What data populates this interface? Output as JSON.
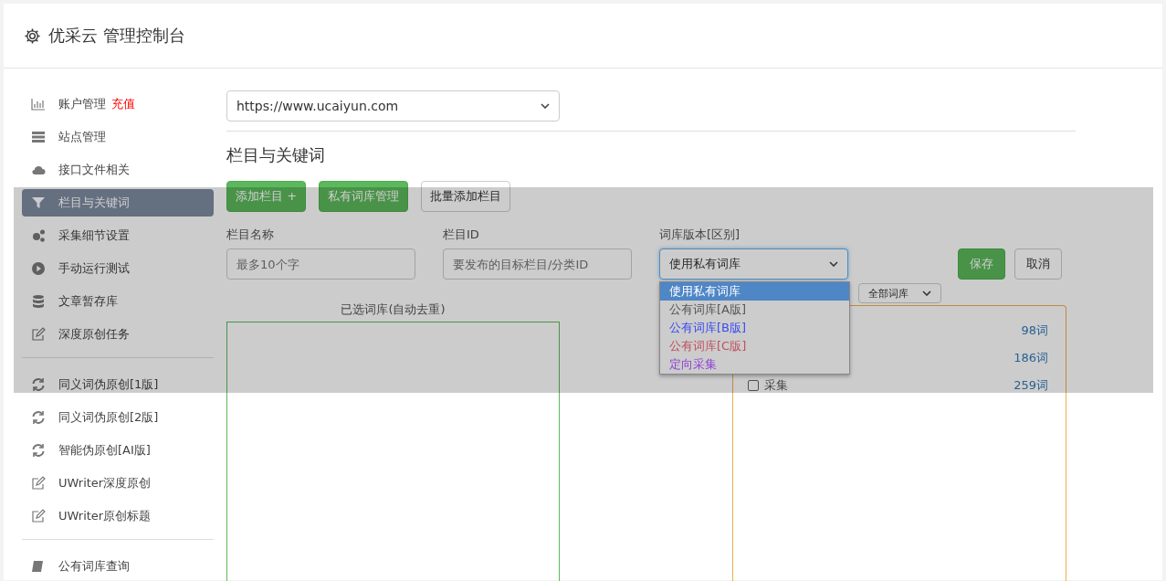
{
  "header": {
    "title": "优采云 管理控制台"
  },
  "sidebar": {
    "groups": [
      {
        "items": [
          {
            "label": "账户管理",
            "badge": "充值",
            "selected": false
          },
          {
            "label": "站点管理",
            "selected": false
          },
          {
            "label": "接口文件相关",
            "selected": false
          },
          {
            "label": "栏目与关键词",
            "selected": true
          },
          {
            "label": "采集细节设置",
            "selected": false
          },
          {
            "label": "手动运行测试",
            "selected": false
          },
          {
            "label": "文章暂存库",
            "selected": false
          },
          {
            "label": "深度原创任务",
            "selected": false
          }
        ]
      },
      {
        "items": [
          {
            "label": "同义词伪原创[1版]",
            "selected": false
          },
          {
            "label": "同义词伪原创[2版]",
            "selected": false
          },
          {
            "label": "智能伪原创[AI版]",
            "selected": false
          },
          {
            "label": "UWriter深度原创",
            "selected": false
          },
          {
            "label": "UWriter原创标题",
            "selected": false
          }
        ]
      },
      {
        "items": [
          {
            "label": "公有词库查询",
            "selected": false
          }
        ]
      }
    ]
  },
  "site_select": {
    "value": "https://www.ucaiyun.com"
  },
  "section_title": "栏目与关键词",
  "toolbar": [
    {
      "label": "添加栏目 +",
      "kind": "primary"
    },
    {
      "label": "私有词库管理",
      "kind": "primary"
    },
    {
      "label": "批量添加栏目",
      "kind": "default"
    }
  ],
  "form": {
    "fields": [
      {
        "label": "栏目名称",
        "placeholder": "最多10个字"
      },
      {
        "label": "栏目ID",
        "placeholder": "要发布的目标栏目/分类ID"
      }
    ],
    "version": {
      "label": "词库版本[区别]",
      "value": "使用私有词库",
      "expanded": true,
      "options": [
        {
          "label": "使用私有词库",
          "selected": true
        },
        {
          "label": "公有词库[A版]",
          "selected": false,
          "color": "#555555"
        },
        {
          "label": "公有词库[B版]",
          "selected": false,
          "color": "#3a4cf0"
        },
        {
          "label": "公有词库[C版]",
          "selected": false,
          "color": "#c0505e"
        },
        {
          "label": "定向采集",
          "selected": false,
          "color": "#9040d8"
        }
      ]
    },
    "save": "保存",
    "cancel": "取消"
  },
  "selected_panel": {
    "title": "已选词库(自动去重)"
  },
  "library_panel": {
    "filter": "全部词库",
    "rows": [
      {
        "count": "98词"
      },
      {
        "count": "186词"
      },
      {
        "label": "采集",
        "checked": false,
        "count": "259词"
      }
    ]
  }
}
